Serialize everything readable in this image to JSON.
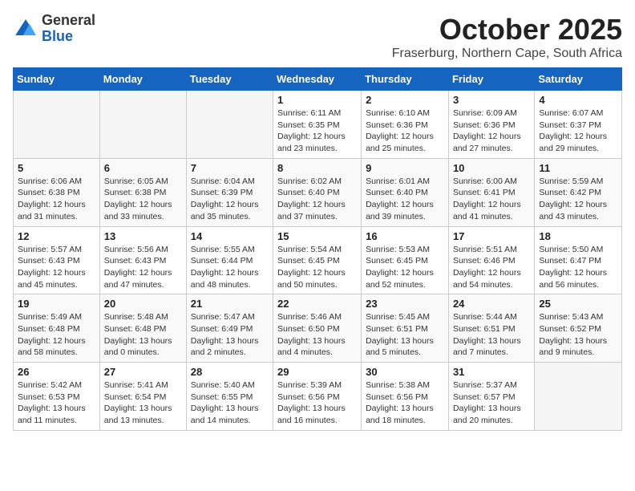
{
  "logo": {
    "general": "General",
    "blue": "Blue"
  },
  "title": "October 2025",
  "subtitle": "Fraserburg, Northern Cape, South Africa",
  "days_of_week": [
    "Sunday",
    "Monday",
    "Tuesday",
    "Wednesday",
    "Thursday",
    "Friday",
    "Saturday"
  ],
  "weeks": [
    [
      {
        "day": "",
        "info": ""
      },
      {
        "day": "",
        "info": ""
      },
      {
        "day": "",
        "info": ""
      },
      {
        "day": "1",
        "info": "Sunrise: 6:11 AM\nSunset: 6:35 PM\nDaylight: 12 hours\nand 23 minutes."
      },
      {
        "day": "2",
        "info": "Sunrise: 6:10 AM\nSunset: 6:36 PM\nDaylight: 12 hours\nand 25 minutes."
      },
      {
        "day": "3",
        "info": "Sunrise: 6:09 AM\nSunset: 6:36 PM\nDaylight: 12 hours\nand 27 minutes."
      },
      {
        "day": "4",
        "info": "Sunrise: 6:07 AM\nSunset: 6:37 PM\nDaylight: 12 hours\nand 29 minutes."
      }
    ],
    [
      {
        "day": "5",
        "info": "Sunrise: 6:06 AM\nSunset: 6:38 PM\nDaylight: 12 hours\nand 31 minutes."
      },
      {
        "day": "6",
        "info": "Sunrise: 6:05 AM\nSunset: 6:38 PM\nDaylight: 12 hours\nand 33 minutes."
      },
      {
        "day": "7",
        "info": "Sunrise: 6:04 AM\nSunset: 6:39 PM\nDaylight: 12 hours\nand 35 minutes."
      },
      {
        "day": "8",
        "info": "Sunrise: 6:02 AM\nSunset: 6:40 PM\nDaylight: 12 hours\nand 37 minutes."
      },
      {
        "day": "9",
        "info": "Sunrise: 6:01 AM\nSunset: 6:40 PM\nDaylight: 12 hours\nand 39 minutes."
      },
      {
        "day": "10",
        "info": "Sunrise: 6:00 AM\nSunset: 6:41 PM\nDaylight: 12 hours\nand 41 minutes."
      },
      {
        "day": "11",
        "info": "Sunrise: 5:59 AM\nSunset: 6:42 PM\nDaylight: 12 hours\nand 43 minutes."
      }
    ],
    [
      {
        "day": "12",
        "info": "Sunrise: 5:57 AM\nSunset: 6:43 PM\nDaylight: 12 hours\nand 45 minutes."
      },
      {
        "day": "13",
        "info": "Sunrise: 5:56 AM\nSunset: 6:43 PM\nDaylight: 12 hours\nand 47 minutes."
      },
      {
        "day": "14",
        "info": "Sunrise: 5:55 AM\nSunset: 6:44 PM\nDaylight: 12 hours\nand 48 minutes."
      },
      {
        "day": "15",
        "info": "Sunrise: 5:54 AM\nSunset: 6:45 PM\nDaylight: 12 hours\nand 50 minutes."
      },
      {
        "day": "16",
        "info": "Sunrise: 5:53 AM\nSunset: 6:45 PM\nDaylight: 12 hours\nand 52 minutes."
      },
      {
        "day": "17",
        "info": "Sunrise: 5:51 AM\nSunset: 6:46 PM\nDaylight: 12 hours\nand 54 minutes."
      },
      {
        "day": "18",
        "info": "Sunrise: 5:50 AM\nSunset: 6:47 PM\nDaylight: 12 hours\nand 56 minutes."
      }
    ],
    [
      {
        "day": "19",
        "info": "Sunrise: 5:49 AM\nSunset: 6:48 PM\nDaylight: 12 hours\nand 58 minutes."
      },
      {
        "day": "20",
        "info": "Sunrise: 5:48 AM\nSunset: 6:48 PM\nDaylight: 13 hours\nand 0 minutes."
      },
      {
        "day": "21",
        "info": "Sunrise: 5:47 AM\nSunset: 6:49 PM\nDaylight: 13 hours\nand 2 minutes."
      },
      {
        "day": "22",
        "info": "Sunrise: 5:46 AM\nSunset: 6:50 PM\nDaylight: 13 hours\nand 4 minutes."
      },
      {
        "day": "23",
        "info": "Sunrise: 5:45 AM\nSunset: 6:51 PM\nDaylight: 13 hours\nand 5 minutes."
      },
      {
        "day": "24",
        "info": "Sunrise: 5:44 AM\nSunset: 6:51 PM\nDaylight: 13 hours\nand 7 minutes."
      },
      {
        "day": "25",
        "info": "Sunrise: 5:43 AM\nSunset: 6:52 PM\nDaylight: 13 hours\nand 9 minutes."
      }
    ],
    [
      {
        "day": "26",
        "info": "Sunrise: 5:42 AM\nSunset: 6:53 PM\nDaylight: 13 hours\nand 11 minutes."
      },
      {
        "day": "27",
        "info": "Sunrise: 5:41 AM\nSunset: 6:54 PM\nDaylight: 13 hours\nand 13 minutes."
      },
      {
        "day": "28",
        "info": "Sunrise: 5:40 AM\nSunset: 6:55 PM\nDaylight: 13 hours\nand 14 minutes."
      },
      {
        "day": "29",
        "info": "Sunrise: 5:39 AM\nSunset: 6:56 PM\nDaylight: 13 hours\nand 16 minutes."
      },
      {
        "day": "30",
        "info": "Sunrise: 5:38 AM\nSunset: 6:56 PM\nDaylight: 13 hours\nand 18 minutes."
      },
      {
        "day": "31",
        "info": "Sunrise: 5:37 AM\nSunset: 6:57 PM\nDaylight: 13 hours\nand 20 minutes."
      },
      {
        "day": "",
        "info": ""
      }
    ]
  ]
}
